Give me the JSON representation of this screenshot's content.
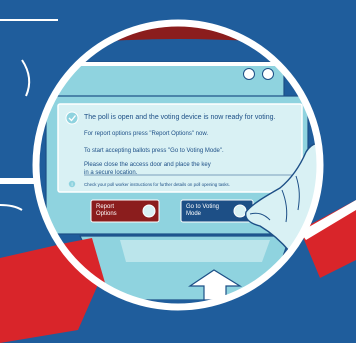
{
  "dialog": {
    "title": "The poll is open and the voting device is now ready for voting.",
    "report_instruction": "For report options press \"Report Options\" now.",
    "start_instruction": "To start accepting ballots press \"Go to Voting Mode\".",
    "close_instruction_line1": "Please close the access door and place the key",
    "close_instruction_line2": "in a secure location.",
    "note": "Check your poll worker instructions for further details on poll opening tasks."
  },
  "buttons": {
    "report_options_line1": "Report",
    "report_options_line2": "Options",
    "go_to_voting_mode_line1": "Go to Voting",
    "go_to_voting_mode_line2": "Mode"
  },
  "colors": {
    "background": "#1f5d9c",
    "dark_red": "#8b1d1d",
    "bright_red": "#e0262b",
    "light_teal": "#d9f1f4",
    "screen_teal": "#8fd3df",
    "navy": "#1d4f86",
    "white": "#ffffff"
  }
}
